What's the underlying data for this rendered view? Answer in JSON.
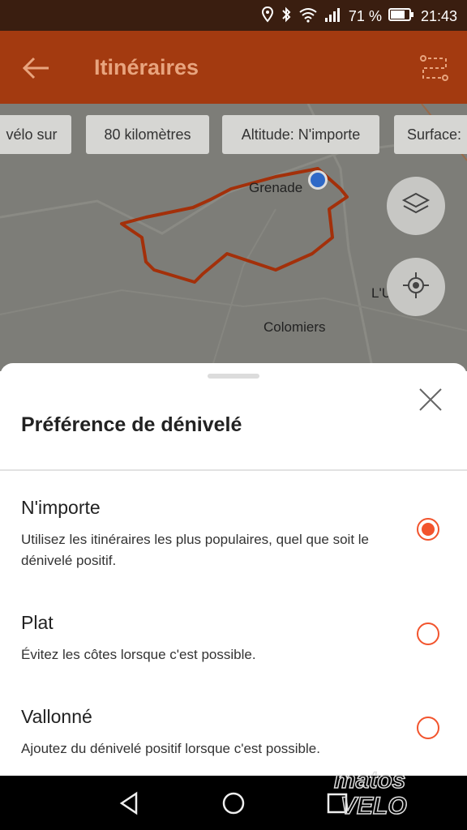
{
  "status_bar": {
    "battery_percent": "71 %",
    "time": "21:43"
  },
  "app_bar": {
    "title": "Itinéraires"
  },
  "filter_chips": [
    "vélo sur",
    "80 kilomètres",
    "Altitude: N'importe",
    "Surface:"
  ],
  "map": {
    "labels": [
      "Grenade",
      "Colomiers",
      "L'U"
    ]
  },
  "sheet": {
    "title": "Préférence de dénivelé",
    "options": [
      {
        "label": "N'importe",
        "description": "Utilisez les itinéraires les plus populaires, quel que soit le dénivelé positif.",
        "selected": true
      },
      {
        "label": "Plat",
        "description": "Évitez les côtes lorsque c'est possible.",
        "selected": false
      },
      {
        "label": "Vallonné",
        "description": "Ajoutez du dénivelé positif lorsque c'est possible.",
        "selected": false
      }
    ]
  },
  "watermark": {
    "line1": "matos",
    "line2": "VELO"
  },
  "colors": {
    "app_bar": "#a33a10",
    "accent": "#f2542d",
    "status_bar": "#3a1e10",
    "map_route": "#a3300a"
  },
  "icons": [
    "location-icon",
    "bluetooth-icon",
    "wifi-icon",
    "signal-icon",
    "battery-icon",
    "back-arrow-icon",
    "route-options-icon",
    "layers-icon",
    "my-location-icon",
    "close-icon",
    "nav-back-icon",
    "nav-home-icon",
    "nav-recents-icon"
  ]
}
